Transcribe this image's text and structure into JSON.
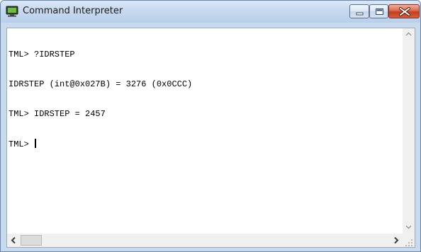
{
  "window": {
    "title": "Command Interpreter",
    "title_icon": "terminal-monitor-icon",
    "buttons": {
      "minimize_icon": "minimize-icon",
      "maximize_icon": "maximize-icon",
      "close_icon": "close-icon"
    }
  },
  "console": {
    "lines": [
      "TML> ?IDRSTEP",
      "IDRSTEP (int@0x027B) = 3276 (0x0CCC)",
      "TML> IDRSTEP = 2457"
    ],
    "prompt": "TML> "
  },
  "scrollbars": {
    "vertical": {
      "up_glyph": "^",
      "down_glyph": "v"
    },
    "horizontal": {
      "left_glyph": "<",
      "right_glyph": ">"
    }
  },
  "colors": {
    "frame": "#c8daee",
    "close_button": "#c43d1d",
    "console_background": "#ffffff",
    "console_text": "#000000"
  }
}
